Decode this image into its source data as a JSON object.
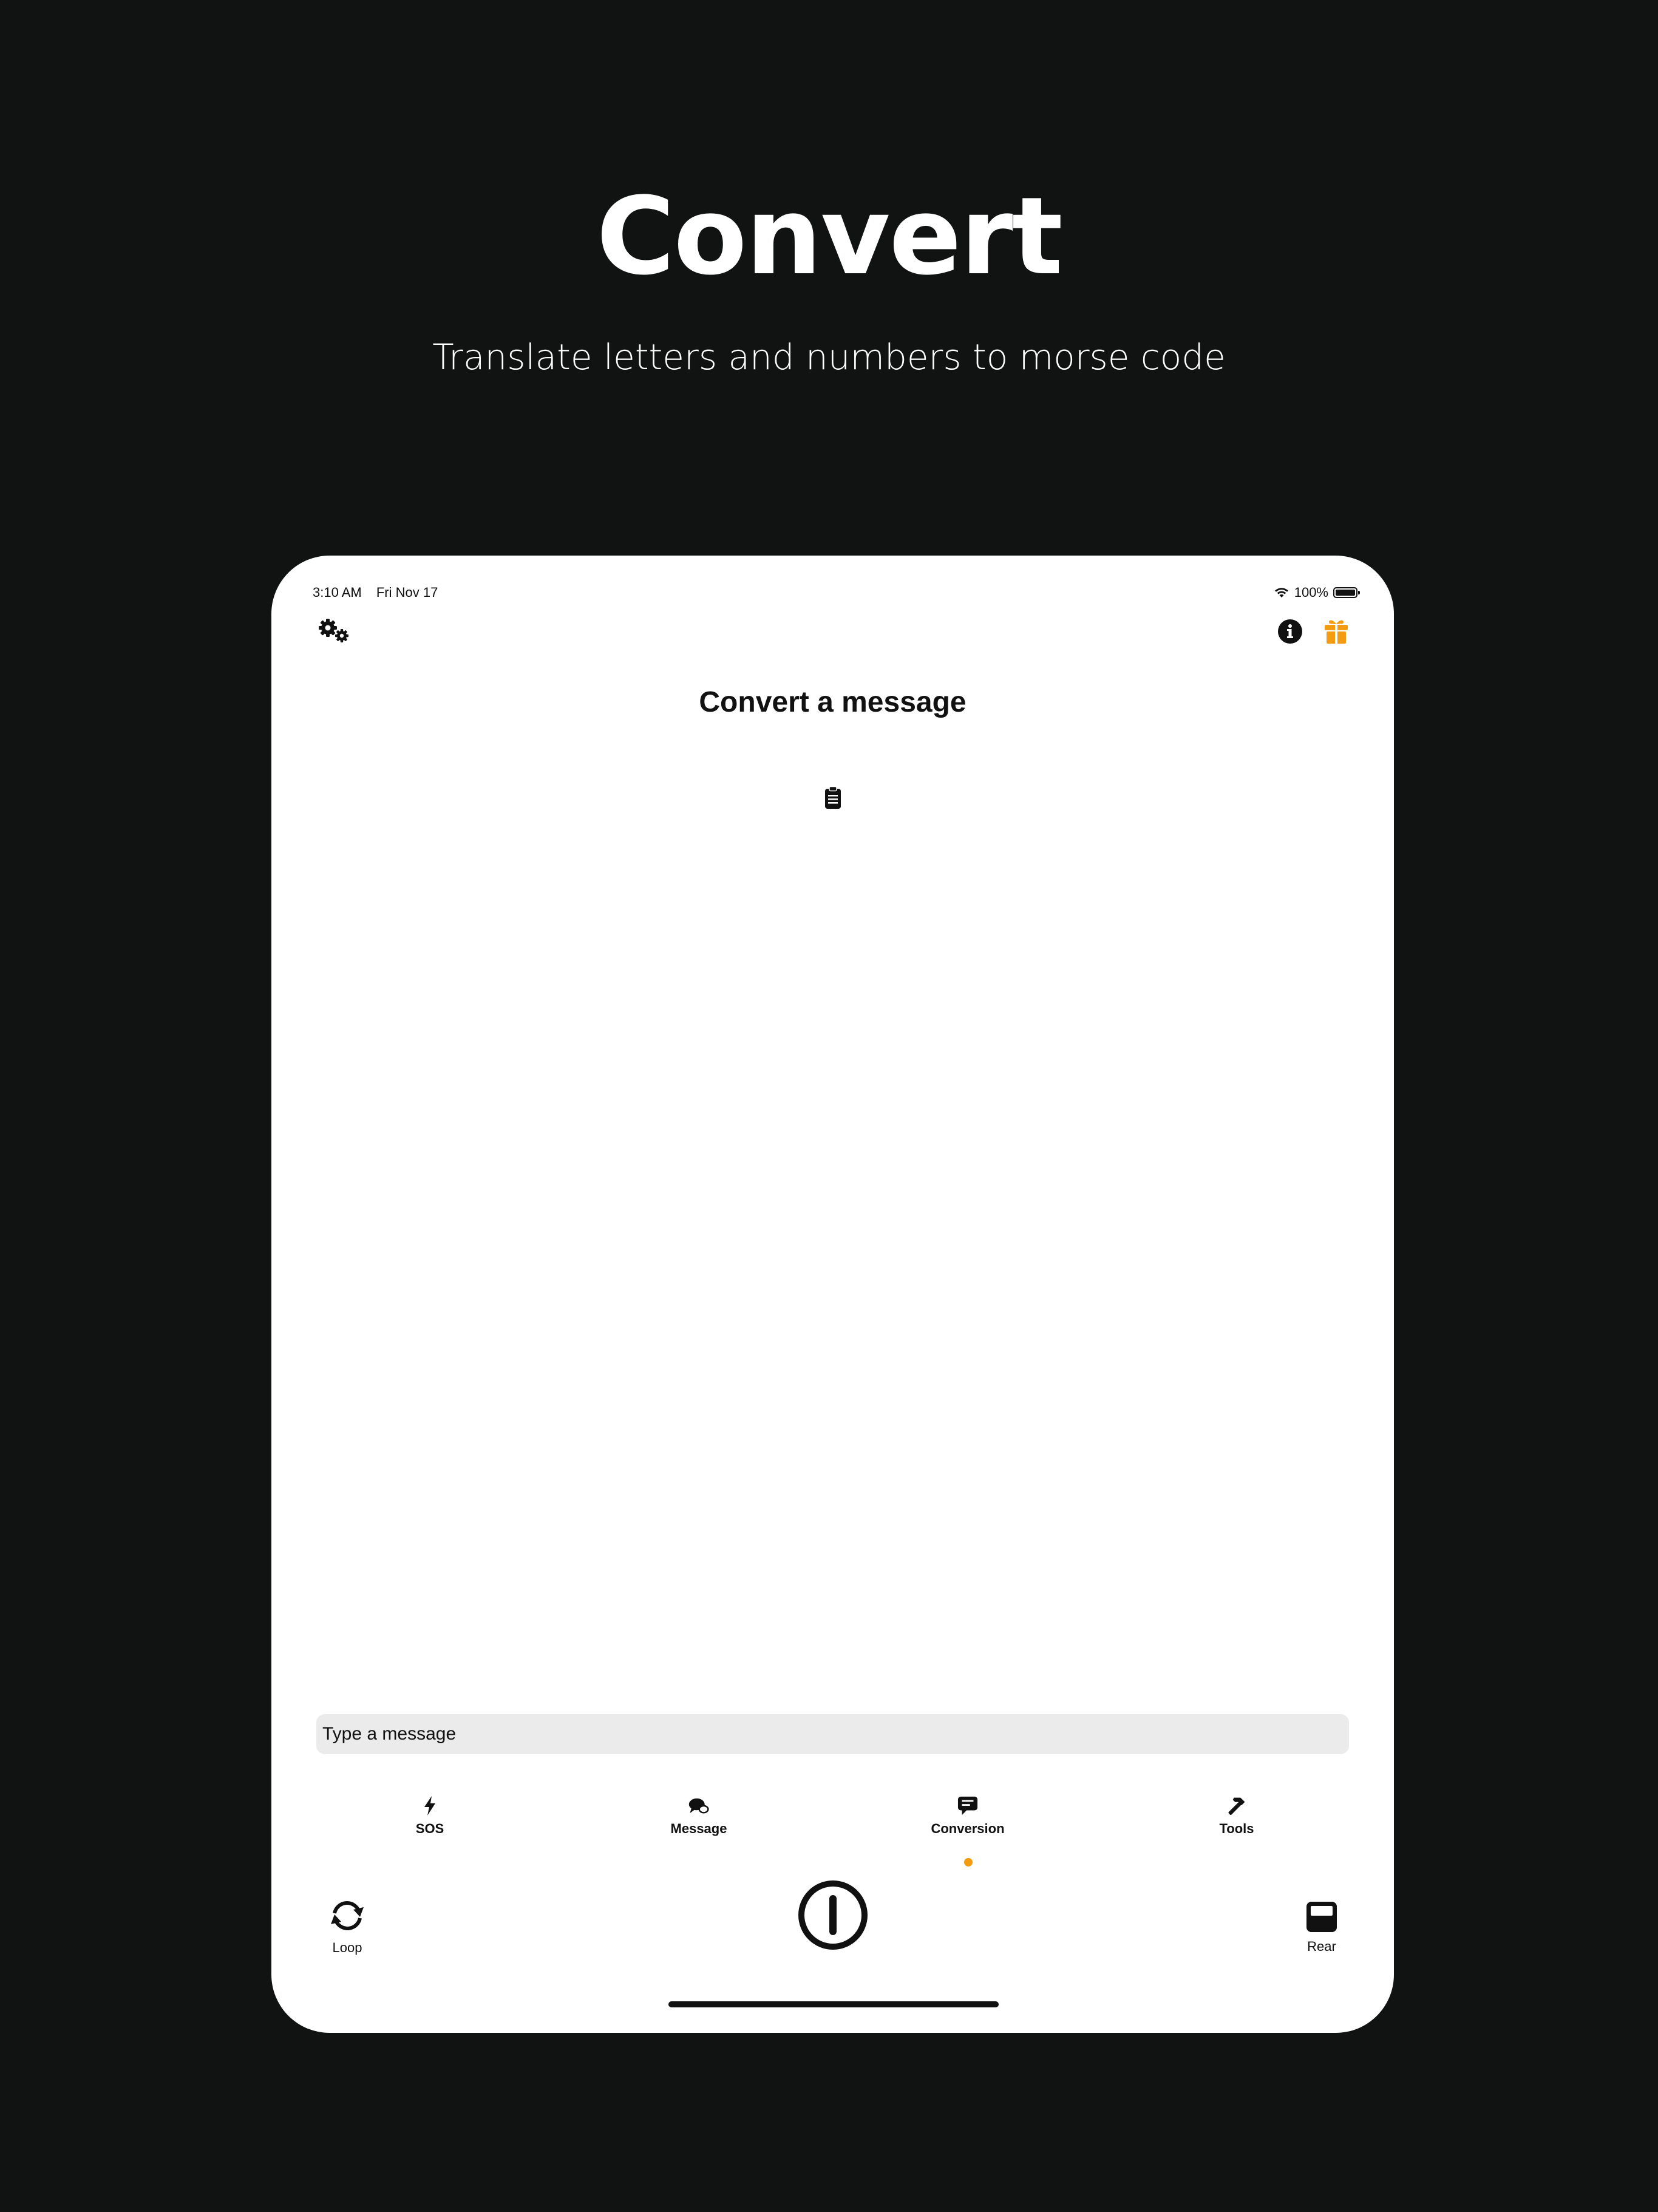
{
  "hero": {
    "title": "Convert",
    "subtitle": "Translate letters and numbers to morse code"
  },
  "status_bar": {
    "time": "3:10 AM",
    "date": "Fri Nov 17",
    "battery": "100%",
    "icons": [
      "wifi-icon",
      "battery-icon"
    ]
  },
  "toolbar": {
    "left_icon": "gears-icon",
    "right_icons": [
      "info-icon",
      "gift-icon"
    ],
    "accent_color": "#f39c12"
  },
  "screen": {
    "title": "Convert a message",
    "clipboard_icon": "clipboard-icon"
  },
  "input": {
    "placeholder": "Type a message"
  },
  "tabs": [
    {
      "label": "SOS",
      "icon": "bolt-icon"
    },
    {
      "label": "Message",
      "icon": "chat-bubbles-icon"
    },
    {
      "label": "Conversion",
      "icon": "message-text-icon",
      "selected": true
    },
    {
      "label": "Tools",
      "icon": "hammer-icon"
    }
  ],
  "controls": {
    "loop_label": "Loop",
    "power_icon": "power-icon",
    "rear_label": "Rear"
  }
}
